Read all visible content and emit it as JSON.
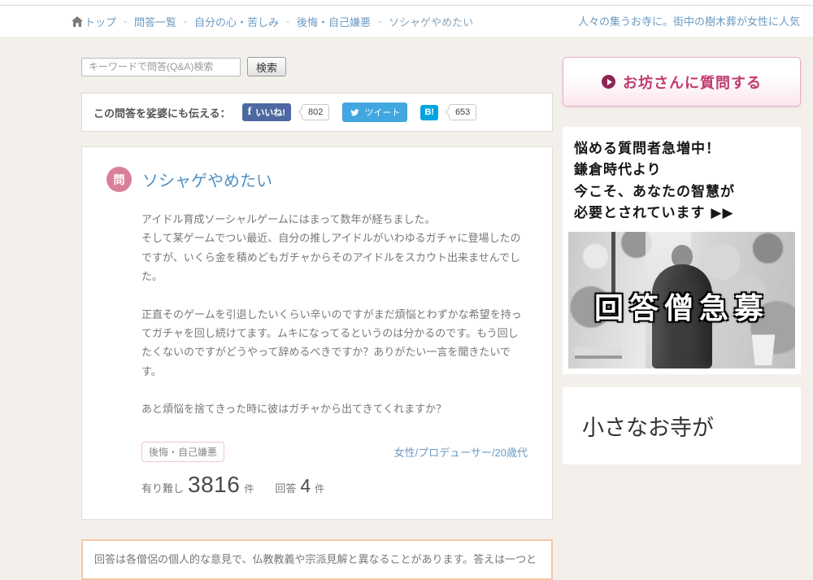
{
  "header": {
    "separator": "-",
    "breadcrumb": [
      {
        "label": "トップ"
      },
      {
        "label": "問答一覧"
      },
      {
        "label": "自分の心・苦しみ"
      },
      {
        "label": "後悔・自己嫌悪"
      },
      {
        "label": "ソシャゲやめたい"
      }
    ],
    "right_link": "人々の集うお寺に。街中の樹木葬が女性に人気"
  },
  "search": {
    "placeholder": "キーワードで問答(Q&A)検索",
    "button_label": "検索"
  },
  "share": {
    "label": "この問答を娑婆にも伝える：",
    "facebook": {
      "label": "いいね!",
      "count": "802"
    },
    "twitter": {
      "label": "ツイート"
    },
    "hatena": {
      "label": "B!",
      "count": "653"
    }
  },
  "question": {
    "badge": "問",
    "title": "ソシャゲやめたい",
    "paragraphs": [
      "アイドル育成ソーシャルゲームにはまって数年が経ちました。",
      "そして某ゲームでつい最近、自分の推しアイドルがいわゆるガチャに登場したのですが、いくら金を積めどもガチャからそのアイドルをスカウト出来ませんでした。",
      "正直そのゲームを引退したいくらい辛いのですがまだ煩悩とわずかな希望を持ってガチャを回し続けてます。ムキになってるというのは分かるのです。もう回したくないのですがどうやって辞めるべきですか？ありがたい一言を聞きたいです。",
      "あと煩悩を捨てきった時に彼はガチャから出てきてくれますか？"
    ],
    "tag": "後悔・自己嫌悪",
    "author": "女性/プロデューサー/20歳代",
    "stats": {
      "arigatashi_label": "有り難し",
      "arigatashi_count": "3816",
      "arigatashi_unit": "件",
      "answers_label": "回答",
      "answers_count": "4",
      "answers_unit": "件"
    }
  },
  "disclaimer": "回答は各僧侶の個人的な意見で、仏教教義や宗派見解と異なることがあります。答えは一つと",
  "sidebar": {
    "ask_button_label": "お坊さんに質問する",
    "ad": {
      "line1": "悩める質問者急増中！",
      "line2": "鎌倉時代より",
      "line3": "今こそ、あなたの智慧が",
      "line4": "必要とされています ▶▶",
      "photo_caption": "回答僧急募"
    },
    "next_card_title": "小さなお寺が"
  },
  "colors": {
    "page_background": "#f3f0ec",
    "link_blue": "#6b9bc3",
    "accent_pink": "#d8809a",
    "ask_magenta": "#c23a6f",
    "facebook_blue": "#4e69a2",
    "twitter_blue": "#42a7e0",
    "hatena_blue": "#00a4de",
    "disclaimer_border": "#f4c7a6"
  }
}
